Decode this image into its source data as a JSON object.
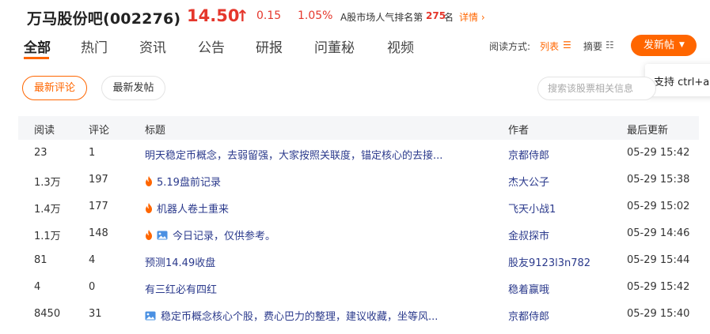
{
  "header": {
    "stock_name": "万马股份吧(002276)",
    "price": "14.50",
    "up_arrow": "↑",
    "change": "0.15",
    "change_pct": "1.05%",
    "rank_label": "A股市场人气排名第",
    "rank_num": "275",
    "rank_unit": "名",
    "detail_link": "详情",
    "price_color": "#e5372c"
  },
  "tabs": [
    {
      "label": "全部"
    },
    {
      "label": "热门"
    },
    {
      "label": "资讯"
    },
    {
      "label": "公告"
    },
    {
      "label": "研报"
    },
    {
      "label": "问董秘"
    },
    {
      "label": "视频"
    }
  ],
  "toolbar": {
    "view_mode_label": "阅读方式:",
    "view_list": "列表",
    "view_summary": "摘要",
    "post_button": "发新帖",
    "tooltip": "支持 ctrl+alt"
  },
  "filters": {
    "latest_comment": "最新评论",
    "latest_post": "最新发帖",
    "search_placeholder": "搜索该股票相关信息"
  },
  "table": {
    "headers": {
      "reads": "阅读",
      "comments": "评论",
      "title": "标题",
      "author": "作者",
      "updated": "最后更新"
    },
    "rows": [
      {
        "reads": "23",
        "comments": "1",
        "title": "明天稳定币概念，去弱留强，大家按照关联度，锚定核心的去接...",
        "author": "京都侍郎",
        "updated": "05-29 15:42",
        "hot": false,
        "image": false
      },
      {
        "reads": "1.3万",
        "comments": "197",
        "title": "5.19盘前记录",
        "author": "杰大公子",
        "updated": "05-29 15:38",
        "hot": true,
        "image": false
      },
      {
        "reads": "1.4万",
        "comments": "177",
        "title": "机器人卷土重来",
        "author": "飞天小战1",
        "updated": "05-29 15:02",
        "hot": true,
        "image": false
      },
      {
        "reads": "1.1万",
        "comments": "148",
        "title": "今日记录，仅供参考。",
        "author": "金叔探市",
        "updated": "05-29 14:46",
        "hot": true,
        "image": true
      },
      {
        "reads": "81",
        "comments": "4",
        "title": "预测14.49收盘",
        "author": "股友9123l3n782",
        "updated": "05-29 15:44",
        "hot": false,
        "image": false
      },
      {
        "reads": "4",
        "comments": "0",
        "title": "有三红必有四红",
        "author": "稳着赢哦",
        "updated": "05-29 15:42",
        "hot": false,
        "image": false
      },
      {
        "reads": "8450",
        "comments": "31",
        "title": "稳定币概念核心个股，费心巴力的整理，建议收藏，坐等风...",
        "author": "京都侍郎",
        "updated": "05-29 15:40",
        "hot": false,
        "image": true
      }
    ]
  },
  "colors": {
    "accent": "#ff6600",
    "link": "#2b3a8c",
    "up": "#e5372c"
  }
}
